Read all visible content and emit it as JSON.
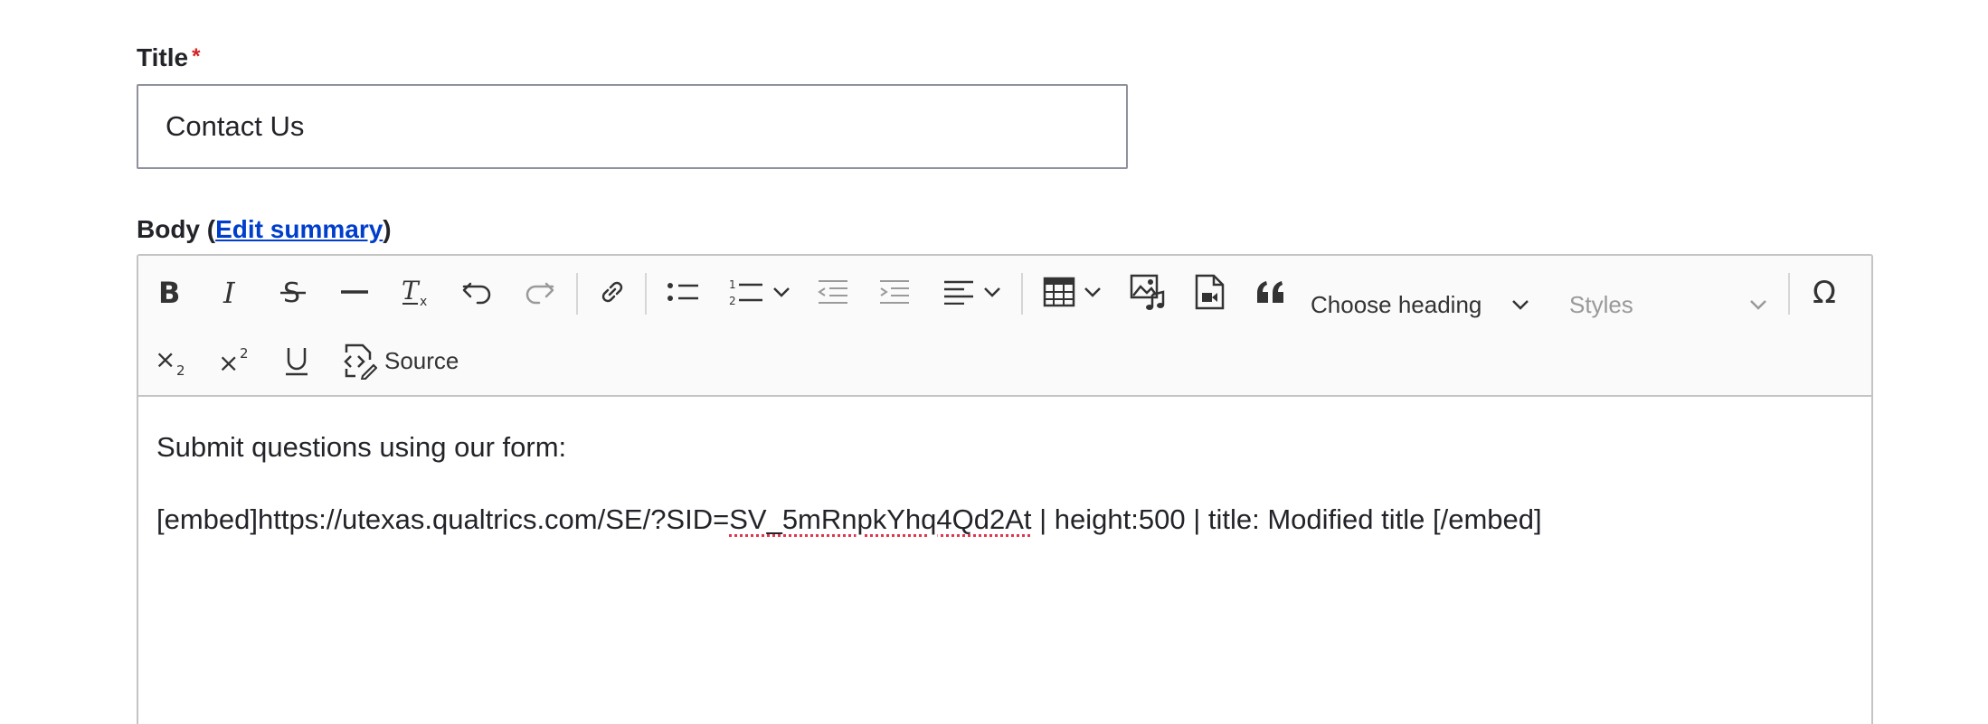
{
  "title_field": {
    "label": "Title",
    "required_mark": "*",
    "value": "Contact Us"
  },
  "body_field": {
    "label_prefix": "Body (",
    "edit_summary_link": "Edit summary",
    "label_suffix": ")"
  },
  "toolbar": {
    "heading_dropdown": "Choose heading",
    "styles_dropdown": "Styles",
    "source_label": "Source"
  },
  "content": {
    "line1": "Submit questions using our form:",
    "line2_before": "[embed]https://utexas.qualtrics.com/SE/?SID=",
    "line2_misspelled": "SV_5mRnpkYhq4Qd2At",
    "line2_after": " | height:500 | title: Modified title [/embed]"
  }
}
